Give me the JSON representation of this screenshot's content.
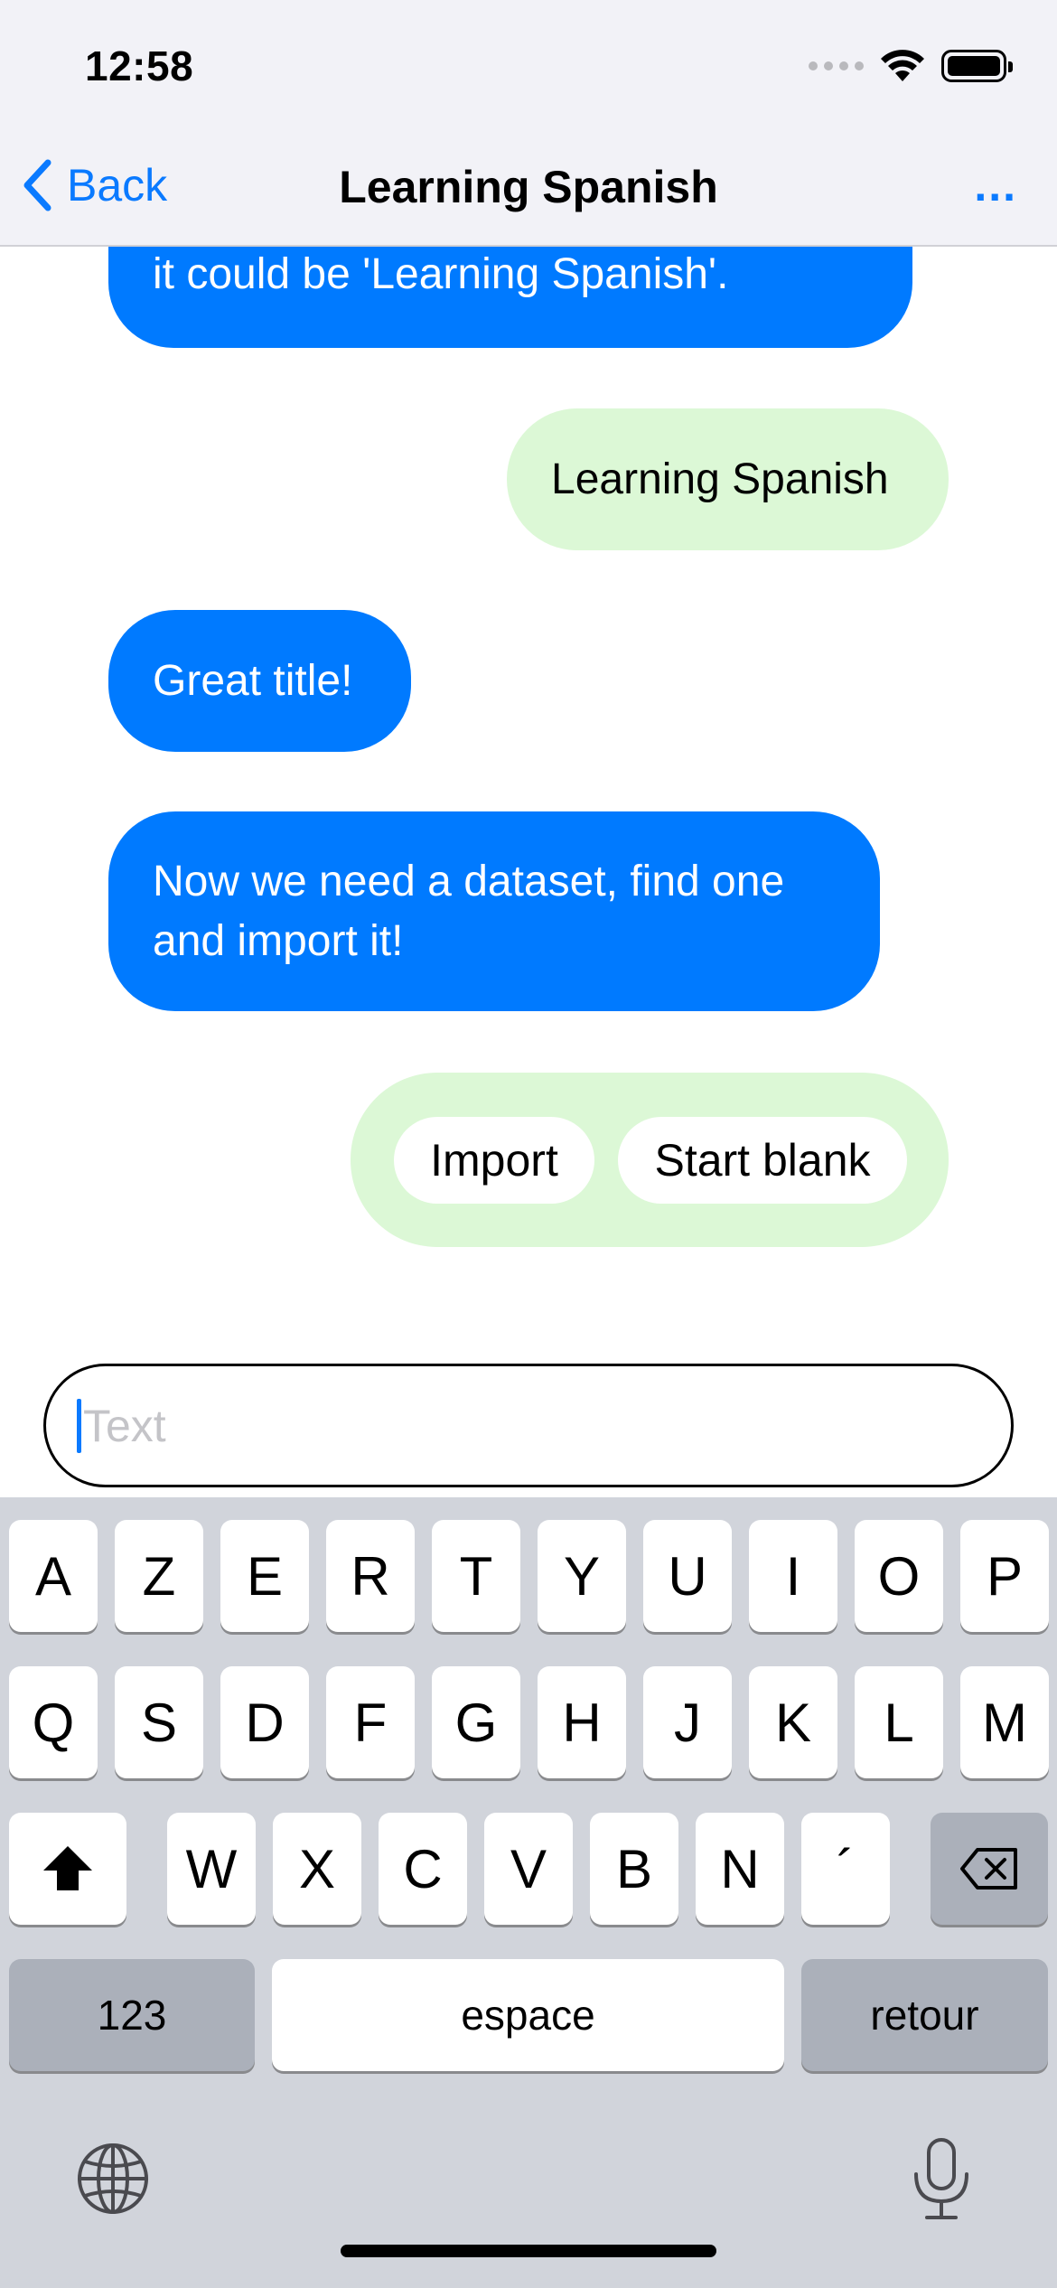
{
  "status_bar": {
    "time": "12:58"
  },
  "nav": {
    "back_label": "Back",
    "title": "Learning Spanish",
    "more_label": "..."
  },
  "messages": [
    {
      "from": "bot",
      "text": "it could be 'Learning Spanish'."
    },
    {
      "from": "user",
      "text": "Learning Spanish"
    },
    {
      "from": "bot",
      "text": "Great title!"
    },
    {
      "from": "bot",
      "text": "Now we need a dataset, find one and import it!"
    }
  ],
  "options": {
    "import_label": "Import",
    "start_blank_label": "Start blank"
  },
  "composer": {
    "placeholder": "Text"
  },
  "keyboard": {
    "row1": [
      "A",
      "Z",
      "E",
      "R",
      "T",
      "Y",
      "U",
      "I",
      "O",
      "P"
    ],
    "row2": [
      "Q",
      "S",
      "D",
      "F",
      "G",
      "H",
      "J",
      "K",
      "L",
      "M"
    ],
    "row3": [
      "W",
      "X",
      "C",
      "V",
      "B",
      "N",
      "´"
    ],
    "numbers_label": "123",
    "space_label": "espace",
    "return_label": "retour"
  },
  "colors": {
    "accent": "#007aff",
    "user_bubble": "#dcf8d6",
    "keyboard_bg": "#d1d4db"
  }
}
